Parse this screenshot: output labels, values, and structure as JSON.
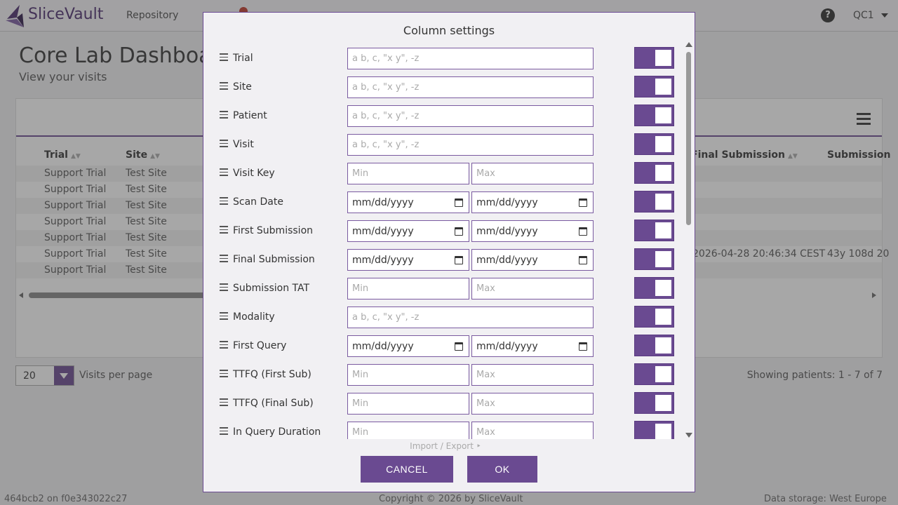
{
  "app": {
    "brand": "SliceVault",
    "nav": [
      "Repository"
    ],
    "user": "QC1",
    "help": "?"
  },
  "page": {
    "title": "Core Lab Dashboard",
    "subtitle": "View your visits"
  },
  "table": {
    "headers": {
      "trial": "Trial",
      "site": "Site",
      "final_submission": "Final Submission",
      "submission": "Submission"
    },
    "rows": [
      {
        "trial": "Support Trial",
        "site": "Test Site",
        "final_submission": "",
        "submission": ""
      },
      {
        "trial": "Support Trial",
        "site": "Test Site",
        "final_submission": "",
        "submission": ""
      },
      {
        "trial": "Support Trial",
        "site": "Test Site",
        "final_submission": "",
        "submission": ""
      },
      {
        "trial": "Support Trial",
        "site": "Test Site",
        "final_submission": "",
        "submission": ""
      },
      {
        "trial": "Support Trial",
        "site": "Test Site",
        "final_submission": "",
        "submission": ""
      },
      {
        "trial": "Support Trial",
        "site": "Test Site",
        "final_submission": "2026-04-28 20:46:34 CEST",
        "submission": "43y 108d 20"
      },
      {
        "trial": "Support Trial",
        "site": "Test Site",
        "final_submission": "",
        "submission": ""
      }
    ],
    "sort_glyph": "▲▼"
  },
  "pager": {
    "per_page": "20",
    "label": "Visits per page",
    "showing": "Showing patients: 1 - 7 of 7"
  },
  "footer": {
    "version": "464bcb2 on f0e343022c27",
    "copyright": "Copyright © 2026 by SliceVault",
    "storage": "Data storage: West Europe"
  },
  "modal": {
    "title": "Column settings",
    "import_export": "Import / Export ‣",
    "cancel": "CANCEL",
    "ok": "OK",
    "text_placeholder": "a b, c, \"x y\", -z",
    "min_placeholder": "Min",
    "max_placeholder": "Max",
    "date_placeholder": "mm/dd/yyyy",
    "columns": [
      {
        "label": "Trial",
        "kind": "text",
        "enabled": true
      },
      {
        "label": "Site",
        "kind": "text",
        "enabled": true
      },
      {
        "label": "Patient",
        "kind": "text",
        "enabled": true
      },
      {
        "label": "Visit",
        "kind": "text",
        "enabled": true
      },
      {
        "label": "Visit Key",
        "kind": "range",
        "enabled": true
      },
      {
        "label": "Scan Date",
        "kind": "date",
        "enabled": true
      },
      {
        "label": "First Submission",
        "kind": "date",
        "enabled": true
      },
      {
        "label": "Final Submission",
        "kind": "date",
        "enabled": true
      },
      {
        "label": "Submission TAT",
        "kind": "range",
        "enabled": true
      },
      {
        "label": "Modality",
        "kind": "text",
        "enabled": true
      },
      {
        "label": "First Query",
        "kind": "date",
        "enabled": true
      },
      {
        "label": "TTFQ (First Sub)",
        "kind": "range",
        "enabled": true
      },
      {
        "label": "TTFQ (Final Sub)",
        "kind": "range",
        "enabled": true
      },
      {
        "label": "In Query Duration",
        "kind": "range",
        "enabled": true
      }
    ]
  },
  "colors": {
    "accent": "#6a4a91"
  }
}
